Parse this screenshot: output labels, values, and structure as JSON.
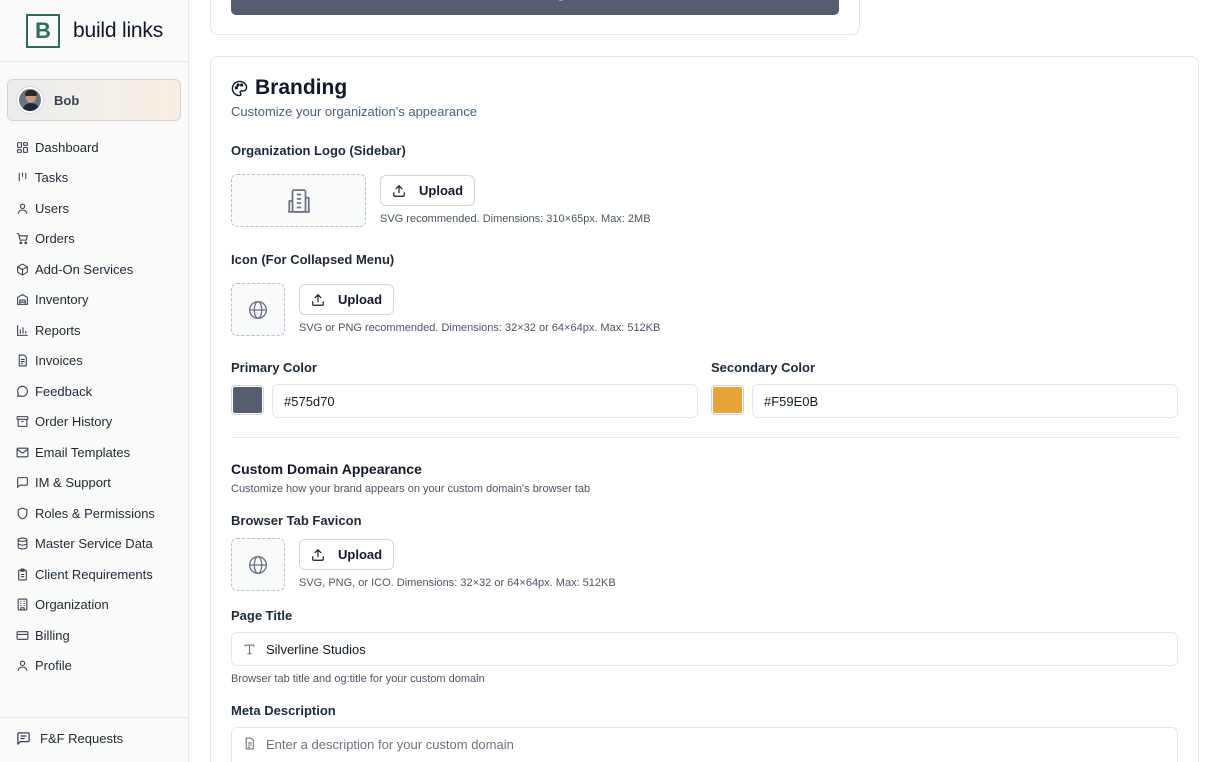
{
  "brand": {
    "mark": "B",
    "name": "build links"
  },
  "user": {
    "name": "Bob"
  },
  "nav": [
    {
      "label": "Dashboard",
      "icon": "dashboard-icon"
    },
    {
      "label": "Tasks",
      "icon": "tasks-icon"
    },
    {
      "label": "Users",
      "icon": "user-icon"
    },
    {
      "label": "Orders",
      "icon": "cart-icon"
    },
    {
      "label": "Add-On Services",
      "icon": "package-icon"
    },
    {
      "label": "Inventory",
      "icon": "warehouse-icon"
    },
    {
      "label": "Reports",
      "icon": "bar-chart-icon"
    },
    {
      "label": "Invoices",
      "icon": "invoice-icon"
    },
    {
      "label": "Feedback",
      "icon": "message-circle-icon"
    },
    {
      "label": "Order History",
      "icon": "archive-icon"
    },
    {
      "label": "Email Templates",
      "icon": "mail-icon"
    },
    {
      "label": "IM & Support",
      "icon": "message-square-icon"
    },
    {
      "label": "Roles & Permissions",
      "icon": "shield-icon"
    },
    {
      "label": "Master Service Data",
      "icon": "database-icon"
    },
    {
      "label": "Client Requirements",
      "icon": "clipboard-icon"
    },
    {
      "label": "Organization",
      "icon": "building-icon"
    },
    {
      "label": "Billing",
      "icon": "credit-card-icon"
    },
    {
      "label": "Profile",
      "icon": "user-icon"
    }
  ],
  "footer_nav": {
    "label": "F&F Requests",
    "icon": "message-lines-icon"
  },
  "top_card": {
    "save_label": "Save Changes"
  },
  "branding": {
    "title": "Branding",
    "subtitle": "Customize your organization's appearance",
    "logo": {
      "label": "Organization Logo (Sidebar)",
      "upload_label": "Upload",
      "hint": "SVG recommended. Dimensions: 310×65px. Max: 2MB"
    },
    "icon": {
      "label": "Icon (For Collapsed Menu)",
      "upload_label": "Upload",
      "hint": "SVG or PNG recommended. Dimensions: 32×32 or 64×64px. Max: 512KB"
    },
    "primary_color": {
      "label": "Primary Color",
      "value": "#575d70",
      "swatch": "#575d70"
    },
    "secondary_color": {
      "label": "Secondary Color",
      "value": "#F59E0B",
      "swatch": "#e8a23a"
    }
  },
  "custom_domain": {
    "title": "Custom Domain Appearance",
    "subtitle": "Customize how your brand appears on your custom domain's browser tab",
    "favicon": {
      "label": "Browser Tab Favicon",
      "upload_label": "Upload",
      "hint": "SVG, PNG, or ICO. Dimensions: 32×32 or 64×64px. Max: 512KB"
    },
    "page_title": {
      "label": "Page Title",
      "value": "Silverline Studios",
      "hint": "Browser tab title and og:title for your custom domain"
    },
    "meta_description": {
      "label": "Meta Description",
      "placeholder": "Enter a description for your custom domain"
    }
  },
  "colors": {
    "accent": "#2f6f5a",
    "primary": "#575d70"
  }
}
